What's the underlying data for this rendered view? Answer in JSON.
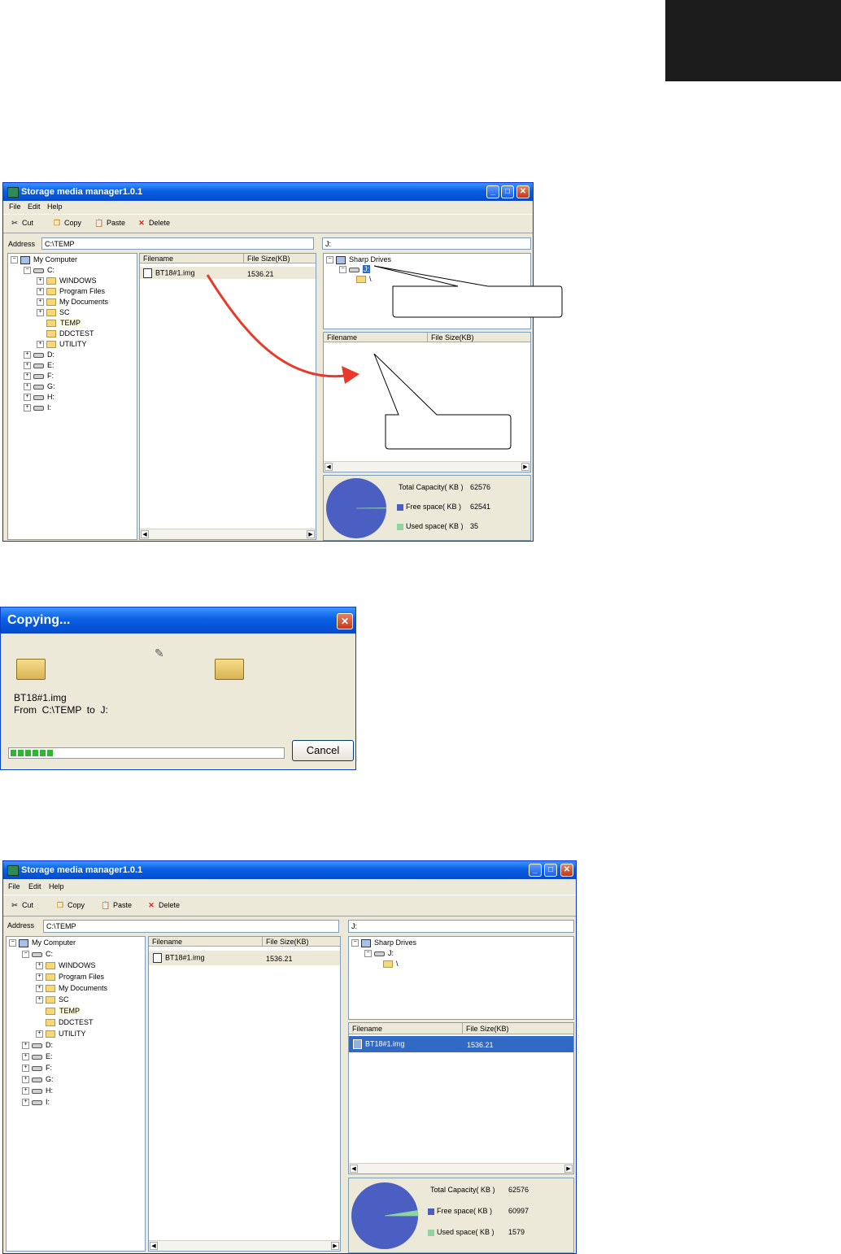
{
  "window1": {
    "title": "Storage media manager1.0.1",
    "menu": [
      "File",
      "Edit",
      "Help"
    ],
    "toolbar": [
      "Cut",
      "Copy",
      "Paste",
      "Delete"
    ],
    "address_label": "Address",
    "address_value": "C:\\TEMP",
    "right_path": "J:",
    "local_tree": {
      "root": "My Computer",
      "drive": "C:",
      "folders": [
        "WINDOWS",
        "Program Files",
        "My Documents",
        "SC",
        "TEMP",
        "DDCTEST",
        "UTILITY"
      ],
      "other_drives": [
        "D:",
        "E:",
        "F:",
        "G:",
        "H:",
        "I:"
      ]
    },
    "file_columns": [
      "Filename",
      "File Size(KB)"
    ],
    "files": [
      {
        "name": "BT18#1.img",
        "size": "1536.21"
      }
    ],
    "sharp_tree": {
      "root": "Sharp Drives",
      "drive": "J:",
      "folder": "\\"
    },
    "dest_columns": [
      "Filename",
      "File Size(KB)"
    ],
    "dest_files": [],
    "capacity": {
      "total_label": "Total Capacity( KB )",
      "total": "62576",
      "free_label": "Free space( KB )",
      "free": "62541",
      "used_label": "Used space( KB )",
      "used": "35"
    }
  },
  "copy_dialog": {
    "title": "Copying...",
    "filename": "BT18#1.img",
    "from_text": "From  C:\\TEMP  to  J:",
    "cancel_label": "Cancel",
    "progress_fraction": 0.16
  },
  "window2": {
    "title": "Storage media manager1.0.1",
    "menu": [
      "File",
      "Edit",
      "Help"
    ],
    "toolbar": [
      "Cut",
      "Copy",
      "Paste",
      "Delete"
    ],
    "address_label": "Address",
    "address_value": "C:\\TEMP",
    "right_path": "J:",
    "local_tree": {
      "root": "My Computer",
      "drive": "C:",
      "folders": [
        "WINDOWS",
        "Program Files",
        "My Documents",
        "SC",
        "TEMP",
        "DDCTEST",
        "UTILITY"
      ],
      "other_drives": [
        "D:",
        "E:",
        "F:",
        "G:",
        "H:",
        "I:"
      ]
    },
    "file_columns": [
      "Filename",
      "File Size(KB)"
    ],
    "files": [
      {
        "name": "BT18#1.img",
        "size": "1536.21"
      }
    ],
    "sharp_tree": {
      "root": "Sharp Drives",
      "drive": "J:",
      "folder": "\\"
    },
    "dest_columns": [
      "Filename",
      "File Size(KB)"
    ],
    "dest_files": [
      {
        "name": "BT18#1.img",
        "size": "1536.21"
      }
    ],
    "capacity": {
      "total_label": "Total Capacity( KB )",
      "total": "62576",
      "free_label": "Free space( KB )",
      "free": "60997",
      "used_label": "Used space( KB )",
      "used": "1579"
    }
  },
  "colors": {
    "pie_free": "#4a5fc1",
    "pie_used": "#8fd4a0",
    "selection": "#316ac5",
    "arrow": "#e8392a"
  }
}
